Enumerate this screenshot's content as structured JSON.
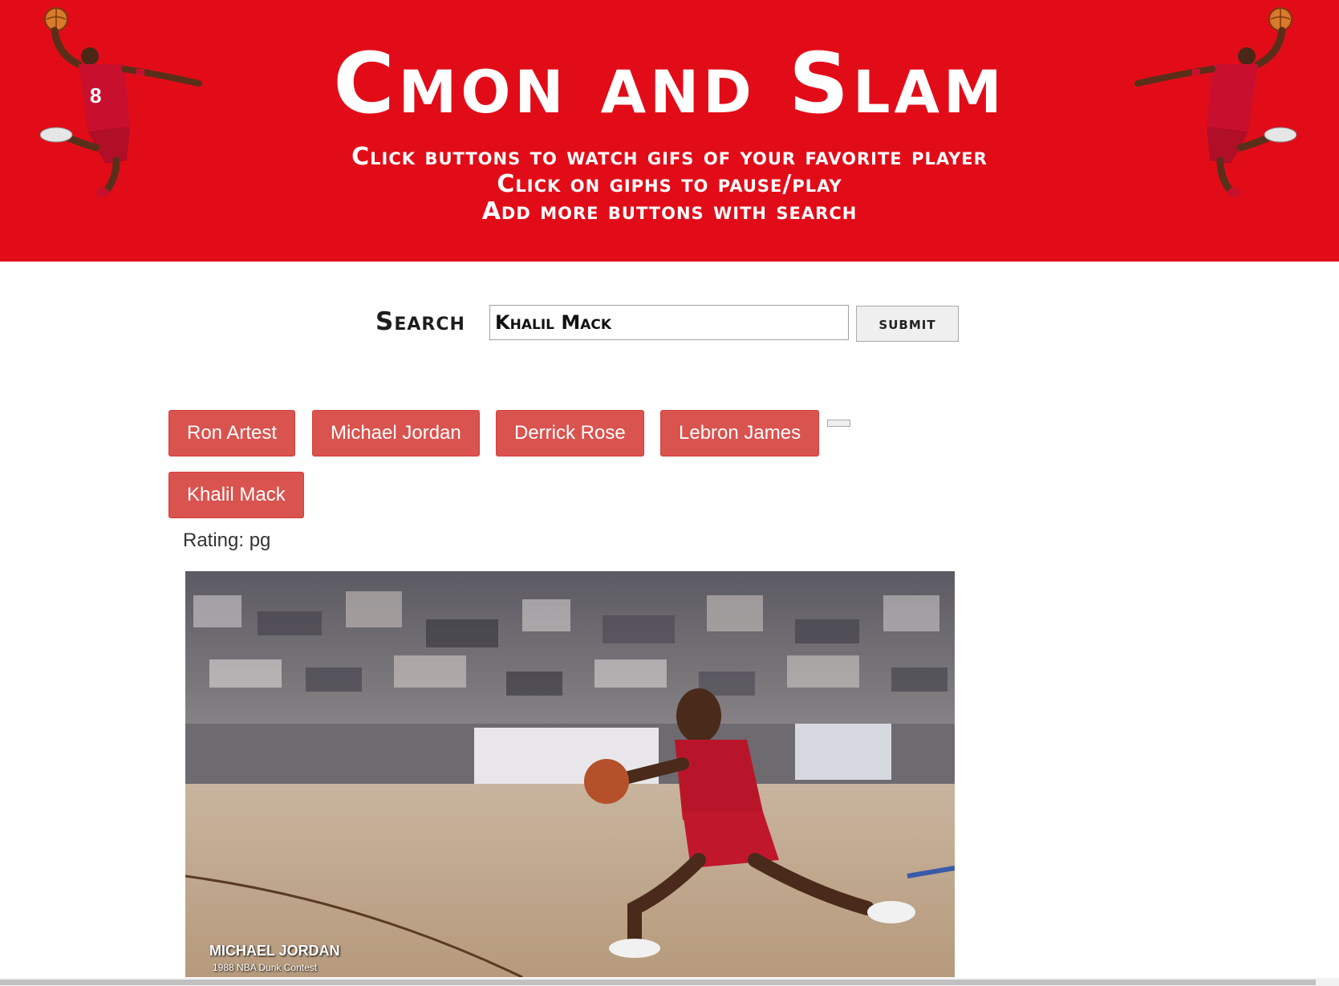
{
  "header": {
    "title": "Cmon and Slam",
    "instructions": [
      "Click buttons to watch gifs of your favorite player",
      "Click on giphs to pause/play",
      "Add more buttons with search"
    ],
    "left_image_icon": "dunking-player-icon",
    "right_image_icon": "dunking-player-icon"
  },
  "search": {
    "label": "Search",
    "value": "Khalil Mack",
    "submit_label": "submit"
  },
  "players": {
    "buttons": [
      "Ron Artest",
      "Michael Jordan",
      "Derrick Rose",
      "Lebron James",
      "Khalil Mack"
    ],
    "empty_button_label": ""
  },
  "results": {
    "rating": "Rating: pg",
    "gif_caption": "MICHAEL JORDAN",
    "gif_subcaption": "1988 NBA Dunk Contest"
  },
  "colors": {
    "header_bg": "#e20c18",
    "button_bg": "#d9534f",
    "button_border": "#d43f3a"
  }
}
